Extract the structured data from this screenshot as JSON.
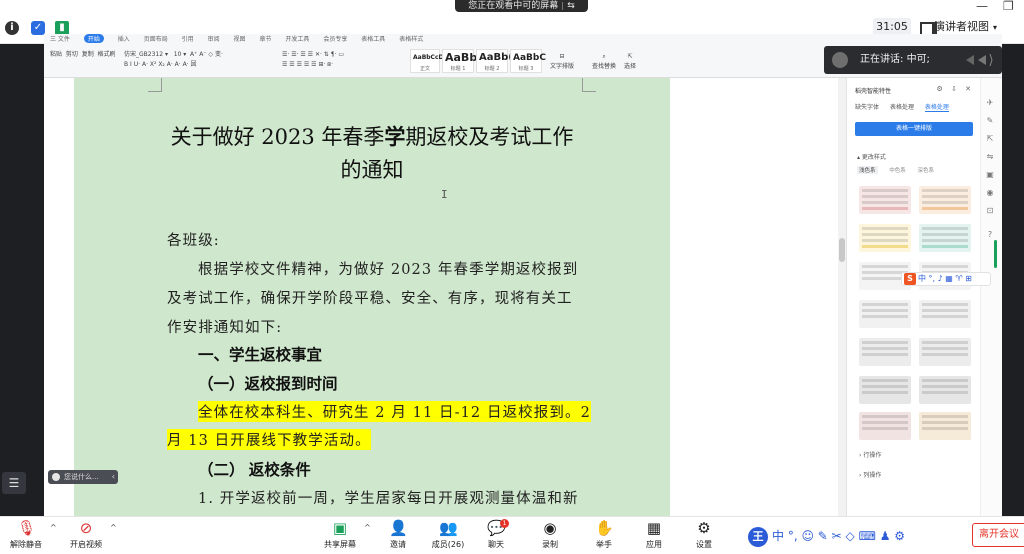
{
  "banner": {
    "text": "您正在观看中可的屏幕"
  },
  "meeting": {
    "timer": "31:05",
    "view_label": "演讲者视图",
    "speaking_prefix": "正在讲话:",
    "speaker": "中可;"
  },
  "ribbon": {
    "tabs": [
      "三 文件",
      "开始",
      "插入",
      "页面布局",
      "引用",
      "审阅",
      "视图",
      "章节",
      "开发工具",
      "会员专享",
      "表格工具",
      "表格样式"
    ],
    "active_tab": "开始",
    "clipboard": [
      "粘贴",
      "剪切",
      "复制",
      "格式刷"
    ],
    "font_name": "仿宋_GB2312",
    "font_size": "10",
    "styles": [
      {
        "sample": "AaBbCcDd",
        "name": "正文"
      },
      {
        "sample": "AaBb",
        "name": "标题 1"
      },
      {
        "sample": "AaBb(",
        "name": "标题 2"
      },
      {
        "sample": "AaBbC",
        "name": "标题 3"
      }
    ],
    "tools": [
      "文字排版",
      "查找替换",
      "选择"
    ]
  },
  "document": {
    "title_line1_pre": "关于做好 2023 年春季",
    "title_line1_bold": "学",
    "title_line1_post": "期返校及考试工作",
    "title_line2": "的通知",
    "greeting": "各班级:",
    "para1_l1": "根据学校文件精神，为做好 2023 年春季学期返校报到",
    "para1_l2": "及考试工作，确保开学阶段平稳、安全、有序，现将有关工",
    "para1_l3": "作安排通知如下:",
    "h1": "一、学生返校事宜",
    "h2": "（一）返校报到时间",
    "hl_l1": "全体在校本科生、研究生 2 月 11 日-12 日返校报到。2",
    "hl_l2": "月 13 日开展线下教学活动。",
    "h3": "（二） 返校条件",
    "item1": "1. 开学返校前一周，学生居家每日开展观测量体温和新",
    "ai_pill": "您说什么..."
  },
  "panel": {
    "title": "稻壳智能特性",
    "tabs": [
      "缺失字体",
      "表格处理",
      "表格处理"
    ],
    "active_tab_index": 2,
    "onekey": "表格一键排版",
    "section": "更改样式",
    "subtabs": [
      "浅色系",
      "中色系",
      "深色系"
    ],
    "expand1": "行操作",
    "expand2": "列操作"
  },
  "toolbar": {
    "items": [
      {
        "label": "解除静音",
        "icon": "mic-off-icon"
      },
      {
        "label": "开启视频",
        "icon": "video-off-icon"
      },
      {
        "label": "共享屏幕",
        "icon": "share-screen-icon"
      },
      {
        "label": "邀请",
        "icon": "invite-icon"
      },
      {
        "label": "成员(26)",
        "icon": "members-icon"
      },
      {
        "label": "聊天",
        "icon": "chat-icon"
      },
      {
        "label": "录制",
        "icon": "record-icon"
      },
      {
        "label": "举手",
        "icon": "raise-hand-icon"
      },
      {
        "label": "应用",
        "icon": "apps-icon"
      },
      {
        "label": "设置",
        "icon": "settings-icon"
      }
    ],
    "chat_badge": "1",
    "leave": "离开会议"
  },
  "ime": {
    "logo": "王",
    "mode": "中"
  },
  "colors": {
    "page_green": "#cfe7cc",
    "highlight": "#ffff00",
    "accent_blue": "#2b7ce9",
    "leave_red": "#e5352b"
  }
}
